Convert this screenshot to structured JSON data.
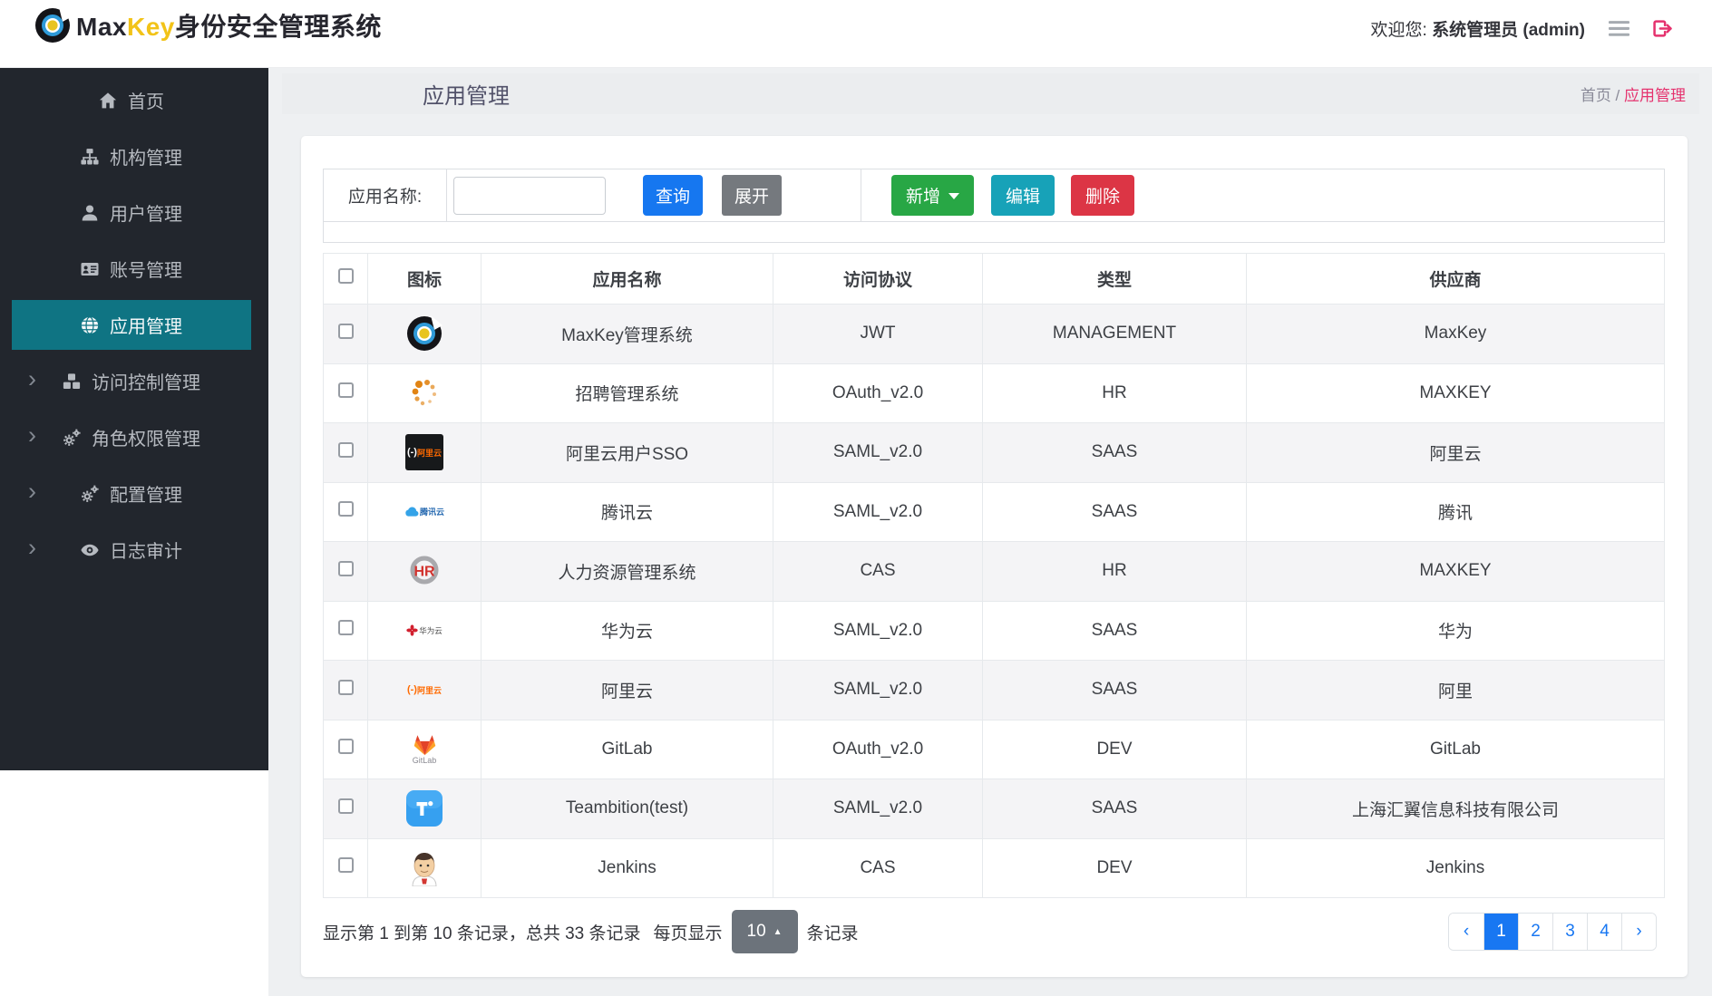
{
  "colors": {
    "active_teal": "#0f7483",
    "brand_yellow": "#f2c318",
    "pink": "#e5326e",
    "btn_blue": "#1677f0",
    "btn_gray": "#75797e",
    "btn_green": "#28a745",
    "btn_teal": "#17a2b8",
    "btn_red": "#dc3545",
    "pagination_blue": "#1877f2",
    "perpage_gray": "#6c737b"
  },
  "header": {
    "brand_max": "Max",
    "brand_key": "Key",
    "brand_suffix": "身份安全管理系统",
    "welcome_prefix": "欢迎您:",
    "welcome_user": "系统管理员 (admin)"
  },
  "sidebar": {
    "items": [
      {
        "key": "home",
        "label": "首页",
        "icon": "home-icon",
        "active": false,
        "expandable": false
      },
      {
        "key": "org",
        "label": "机构管理",
        "icon": "sitemap-icon",
        "active": false,
        "expandable": false
      },
      {
        "key": "user",
        "label": "用户管理",
        "icon": "user-icon",
        "active": false,
        "expandable": false
      },
      {
        "key": "account",
        "label": "账号管理",
        "icon": "id-card-icon",
        "active": false,
        "expandable": false
      },
      {
        "key": "app",
        "label": "应用管理",
        "icon": "globe-icon",
        "active": true,
        "expandable": false
      },
      {
        "key": "access",
        "label": "访问控制管理",
        "icon": "cubes-icon",
        "active": false,
        "expandable": true
      },
      {
        "key": "role",
        "label": "角色权限管理",
        "icon": "gears-icon",
        "active": false,
        "expandable": true
      },
      {
        "key": "config",
        "label": "配置管理",
        "icon": "gears-icon",
        "active": false,
        "expandable": true
      },
      {
        "key": "audit",
        "label": "日志审计",
        "icon": "eye-icon",
        "active": false,
        "expandable": true
      }
    ]
  },
  "page": {
    "title": "应用管理",
    "breadcrumb_home": "首页",
    "breadcrumb_sep": " / ",
    "breadcrumb_current": "应用管理"
  },
  "toolbar": {
    "search_label": "应用名称:",
    "search_value": "",
    "query_label": "查询",
    "expand_label": "展开",
    "add_label": "新增",
    "edit_label": "编辑",
    "delete_label": "删除"
  },
  "table": {
    "columns": [
      "图标",
      "应用名称",
      "访问协议",
      "类型",
      "供应商"
    ],
    "rows": [
      {
        "icon": "maxkey-logo-icon",
        "name": "MaxKey管理系统",
        "protocol": "JWT",
        "type": "MANAGEMENT",
        "vendor": "MaxKey"
      },
      {
        "icon": "recruit-dots-icon",
        "name": "招聘管理系统",
        "protocol": "OAuth_v2.0",
        "type": "HR",
        "vendor": "MAXKEY"
      },
      {
        "icon": "aliyun-dark-icon",
        "name": "阿里云用户SSO",
        "protocol": "SAML_v2.0",
        "type": "SAAS",
        "vendor": "阿里云"
      },
      {
        "icon": "tencent-cloud-icon",
        "name": "腾讯云",
        "protocol": "SAML_v2.0",
        "type": "SAAS",
        "vendor": "腾讯"
      },
      {
        "icon": "hr-logo-icon",
        "name": "人力资源管理系统",
        "protocol": "CAS",
        "type": "HR",
        "vendor": "MAXKEY"
      },
      {
        "icon": "huawei-cloud-icon",
        "name": "华为云",
        "protocol": "SAML_v2.0",
        "type": "SAAS",
        "vendor": "华为"
      },
      {
        "icon": "aliyun-orange-icon",
        "name": "阿里云",
        "protocol": "SAML_v2.0",
        "type": "SAAS",
        "vendor": "阿里"
      },
      {
        "icon": "gitlab-icon",
        "name": "GitLab",
        "protocol": "OAuth_v2.0",
        "type": "DEV",
        "vendor": "GitLab"
      },
      {
        "icon": "teambition-icon",
        "name": "Teambition(test)",
        "protocol": "SAML_v2.0",
        "type": "SAAS",
        "vendor": "上海汇翼信息科技有限公司"
      },
      {
        "icon": "jenkins-icon",
        "name": "Jenkins",
        "protocol": "CAS",
        "type": "DEV",
        "vendor": "Jenkins"
      }
    ]
  },
  "pagination": {
    "info": "显示第 1 到第 10 条记录，总共 33 条记录",
    "per_page_label": "每页显示",
    "per_page_value": "10",
    "per_page_caret": "▲",
    "per_page_suffix": "条记录",
    "pages": [
      {
        "key": "prev",
        "label": "‹",
        "active": false
      },
      {
        "key": "1",
        "label": "1",
        "active": true
      },
      {
        "key": "2",
        "label": "2",
        "active": false
      },
      {
        "key": "3",
        "label": "3",
        "active": false
      },
      {
        "key": "4",
        "label": "4",
        "active": false
      },
      {
        "key": "next",
        "label": "›",
        "active": false
      }
    ]
  }
}
